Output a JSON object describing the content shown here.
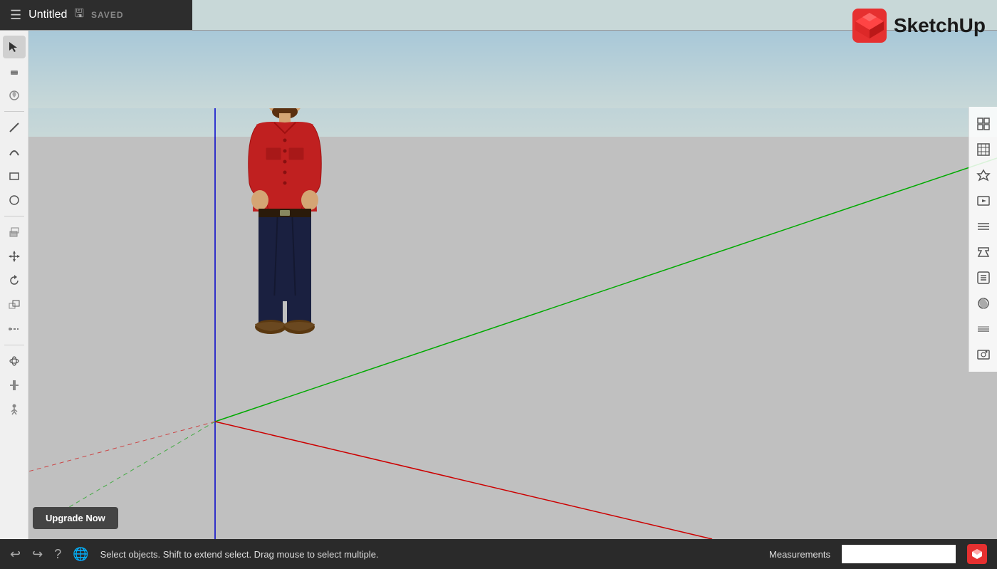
{
  "titlebar": {
    "title": "Untitled",
    "saved_label": "SAVED"
  },
  "logo": {
    "text": "SketchUp"
  },
  "toolbar_left": {
    "tools": [
      {
        "name": "select",
        "icon": "↖",
        "label": "Select"
      },
      {
        "name": "eraser",
        "icon": "◻",
        "label": "Eraser"
      },
      {
        "name": "paint",
        "icon": "⊛",
        "label": "Paint Bucket"
      },
      {
        "name": "line",
        "icon": "╱",
        "label": "Line"
      },
      {
        "name": "arc",
        "icon": "⌒",
        "label": "Arc"
      },
      {
        "name": "rectangle",
        "icon": "▱",
        "label": "Rectangle"
      },
      {
        "name": "circle",
        "icon": "◯",
        "label": "Circle"
      },
      {
        "name": "push-pull",
        "icon": "⬡",
        "label": "Push/Pull"
      },
      {
        "name": "move",
        "icon": "✛",
        "label": "Move"
      },
      {
        "name": "rotate",
        "icon": "↻",
        "label": "Rotate"
      },
      {
        "name": "scale",
        "icon": "⤢",
        "label": "Scale"
      },
      {
        "name": "tape",
        "icon": "⌻",
        "label": "Tape Measure"
      },
      {
        "name": "orbit",
        "icon": "⊕",
        "label": "Orbit"
      },
      {
        "name": "pan",
        "icon": "✋",
        "label": "Pan"
      },
      {
        "name": "walk",
        "icon": "⚐",
        "label": "Walk"
      }
    ]
  },
  "toolbar_right": {
    "tools": [
      {
        "name": "components",
        "icon": "⬚",
        "label": "Components"
      },
      {
        "name": "materials",
        "icon": "▦",
        "label": "Materials"
      },
      {
        "name": "styles",
        "icon": "🎓",
        "label": "Styles"
      },
      {
        "name": "scenes",
        "icon": "⬛",
        "label": "Scenes"
      },
      {
        "name": "layers",
        "icon": "⬜",
        "label": "Layers/Tags"
      },
      {
        "name": "entity-info",
        "icon": "⌂",
        "label": "Entity Info"
      },
      {
        "name": "outliner",
        "icon": "☰",
        "label": "Outliner"
      },
      {
        "name": "shadows",
        "icon": "◑",
        "label": "Shadows"
      },
      {
        "name": "fog",
        "icon": "≋",
        "label": "Fog"
      },
      {
        "name": "match-photo",
        "icon": "◧",
        "label": "Match Photo"
      }
    ]
  },
  "bottombar": {
    "status_text": "Select objects. Shift to extend select. Drag mouse to select multiple.",
    "measurements_label": "Measurements",
    "measurements_value": ""
  },
  "upgrade_btn": {
    "label": "Upgrade Now"
  },
  "scene": {
    "colors": {
      "sky_top": "#a8c8d8",
      "sky_bottom": "#c8d8d8",
      "ground": "#c0c0c0",
      "axis_blue": "#0000cc",
      "axis_green": "#00aa00",
      "axis_red": "#cc0000",
      "axis_red_dotted": "#cc4444",
      "axis_green_dotted": "#44aa44"
    }
  }
}
